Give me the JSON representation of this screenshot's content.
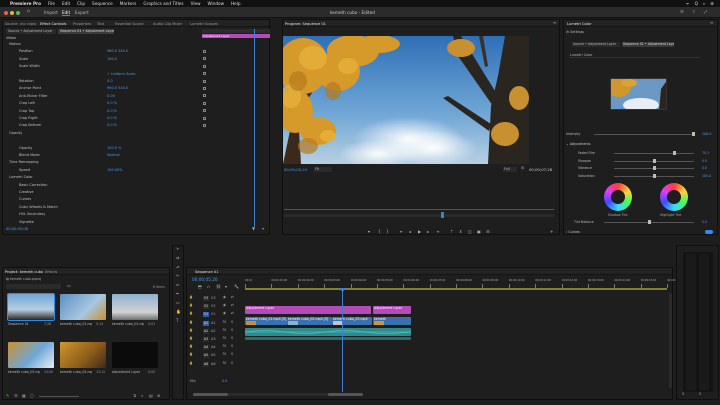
{
  "menubar": {
    "app": "Premiere Pro",
    "items": [
      "File",
      "Edit",
      "Clip",
      "Sequence",
      "Markers",
      "Graphics and Titles",
      "View",
      "Window",
      "Help"
    ],
    "right": [
      "ᯤ",
      "Q",
      "⌕",
      "⚙"
    ]
  },
  "titlebar": {
    "workspaces": [
      "Import",
      "Edit",
      "Export"
    ],
    "active_workspace": "Edit",
    "title": "kemeth cubo - Edited"
  },
  "effect_controls": {
    "tabs": [
      "Source: (no clips)",
      "Effect Controls",
      "Properties",
      "Text",
      "Essential Sound",
      "Audio Clip Mixer",
      "Lumetri Scopes"
    ],
    "source_chip": "Source • Adjustment Layer",
    "sequence_chip": "Sequence 01 • Adjustment Layer",
    "video_label": "Video",
    "mini_clip_label": "Adjustment Layer",
    "rows": [
      {
        "label": "Motion",
        "value": ""
      },
      {
        "label": "Position",
        "value": "960.0   540.0"
      },
      {
        "label": "Scale",
        "value": "100.0"
      },
      {
        "label": "Scale Width",
        "value": ""
      },
      {
        "label": "",
        "value": "✓ Uniform Scale"
      },
      {
        "label": "Rotation",
        "value": "0.0"
      },
      {
        "label": "Anchor Point",
        "value": "960.0   540.0"
      },
      {
        "label": "Anti-flicker Filter",
        "value": "0.00"
      },
      {
        "label": "Crop Left",
        "value": "0.0 %"
      },
      {
        "label": "Crop Top",
        "value": "0.0 %"
      },
      {
        "label": "Crop Right",
        "value": "0.0 %"
      },
      {
        "label": "Crop Bottom",
        "value": "0.0 %"
      },
      {
        "label": "Opacity",
        "value": ""
      },
      {
        "label": "",
        "value": ""
      },
      {
        "label": "Opacity",
        "value": "100.0 %"
      },
      {
        "label": "Blend Mode",
        "value": "Normal"
      },
      {
        "label": "Time Remapping",
        "value": ""
      },
      {
        "label": "Speed",
        "value": "100.00%"
      },
      {
        "label": "Lumetri Color",
        "value": ""
      },
      {
        "label": "Basic Correction",
        "value": ""
      },
      {
        "label": "Creative",
        "value": ""
      },
      {
        "label": "Curves",
        "value": ""
      },
      {
        "label": "Color Wheels & Match",
        "value": ""
      },
      {
        "label": "HSL Secondary",
        "value": ""
      },
      {
        "label": "Vignette",
        "value": ""
      }
    ],
    "timecode": "00;00;05;08"
  },
  "program": {
    "tab": "Program: Sequence 01",
    "timecode": "00;00;05;24",
    "fit": "Fit",
    "quality": "Full",
    "duration": "00;00;07;28"
  },
  "lumetri": {
    "tab": "Lumetri Color",
    "settings": "Settings",
    "source_chip": "Source • Adjustment Layer",
    "sequence_chip": "Sequence 01 • Adjustment Layer",
    "preset": "Lumetri Color",
    "intensity_label": "Intensity",
    "intensity_value": "100.0",
    "adjustments_label": "Adjustments",
    "sliders": [
      {
        "label": "Faded Film",
        "value": "75.3"
      },
      {
        "label": "Sharpen",
        "value": "0.0"
      },
      {
        "label": "Vibrance",
        "value": "0.0"
      },
      {
        "label": "Saturation",
        "value": "100.0"
      }
    ],
    "shadow_label": "Shadow Tint",
    "highlight_label": "Highlight Tint",
    "tint_balance_label": "Tint Balance",
    "tint_balance_value": "0.0",
    "curves_label": "Curves"
  },
  "project": {
    "tabs": [
      "Project: kemeth cubo",
      "Effects"
    ],
    "path": "kemeth cubo.prproj",
    "count": "6 items",
    "items": [
      {
        "name": "Sequence 01",
        "dur": "7;28"
      },
      {
        "name": "kemeth cubo_01.mp4",
        "dur": "5;14"
      },
      {
        "name": "kemeth cubo_02.mp4",
        "dur": "5;01"
      },
      {
        "name": "kemeth cubo_03.mp4",
        "dur": "10;00"
      },
      {
        "name": "kemeth cubo_04.mp4",
        "dur": "13;12"
      },
      {
        "name": "Adjustment Layer",
        "dur": "5;00"
      }
    ]
  },
  "timeline": {
    "tab": "Sequence 01",
    "timecode": "00;00;05;20",
    "ruler": [
      "00;00",
      "00;00;01;00",
      "00;00;02;00",
      "00;00;03;00",
      "00;00;04;00",
      "00;00;05;00",
      "00;00;06;00",
      "00;00;07;00",
      "00;00;08;00",
      "00;00;09;00",
      "00;00;10;00",
      "00;00;11;00",
      "00;00;12;00",
      "00;00;13;00",
      "00;00;14;00",
      "00;00;15;00",
      "00;00;16;00"
    ],
    "video_tracks": [
      "V3",
      "V2",
      "V1"
    ],
    "audio_tracks": [
      "A1",
      "A2",
      "A3",
      "A4",
      "A5",
      "A6"
    ],
    "mix_label": "Mix",
    "mix_value": "0.0",
    "clips": {
      "adj1": "Adjustment Layer",
      "adj2": "Adjustment Layer",
      "v1a": "kemeth cubo_01.mp4 [V]",
      "v1b": "kemeth cubo_02.mp4 [V]",
      "v1c": "kemeth cubo_03.mp4",
      "v1d": "kemeth"
    }
  },
  "colors": {
    "accent": "#2d8ceb",
    "adjustment_clip": "#b44bb8",
    "video_clip": "#3a6fb0",
    "audio_clip": "#2f8a8a",
    "playhead": "#3b7ed6"
  }
}
